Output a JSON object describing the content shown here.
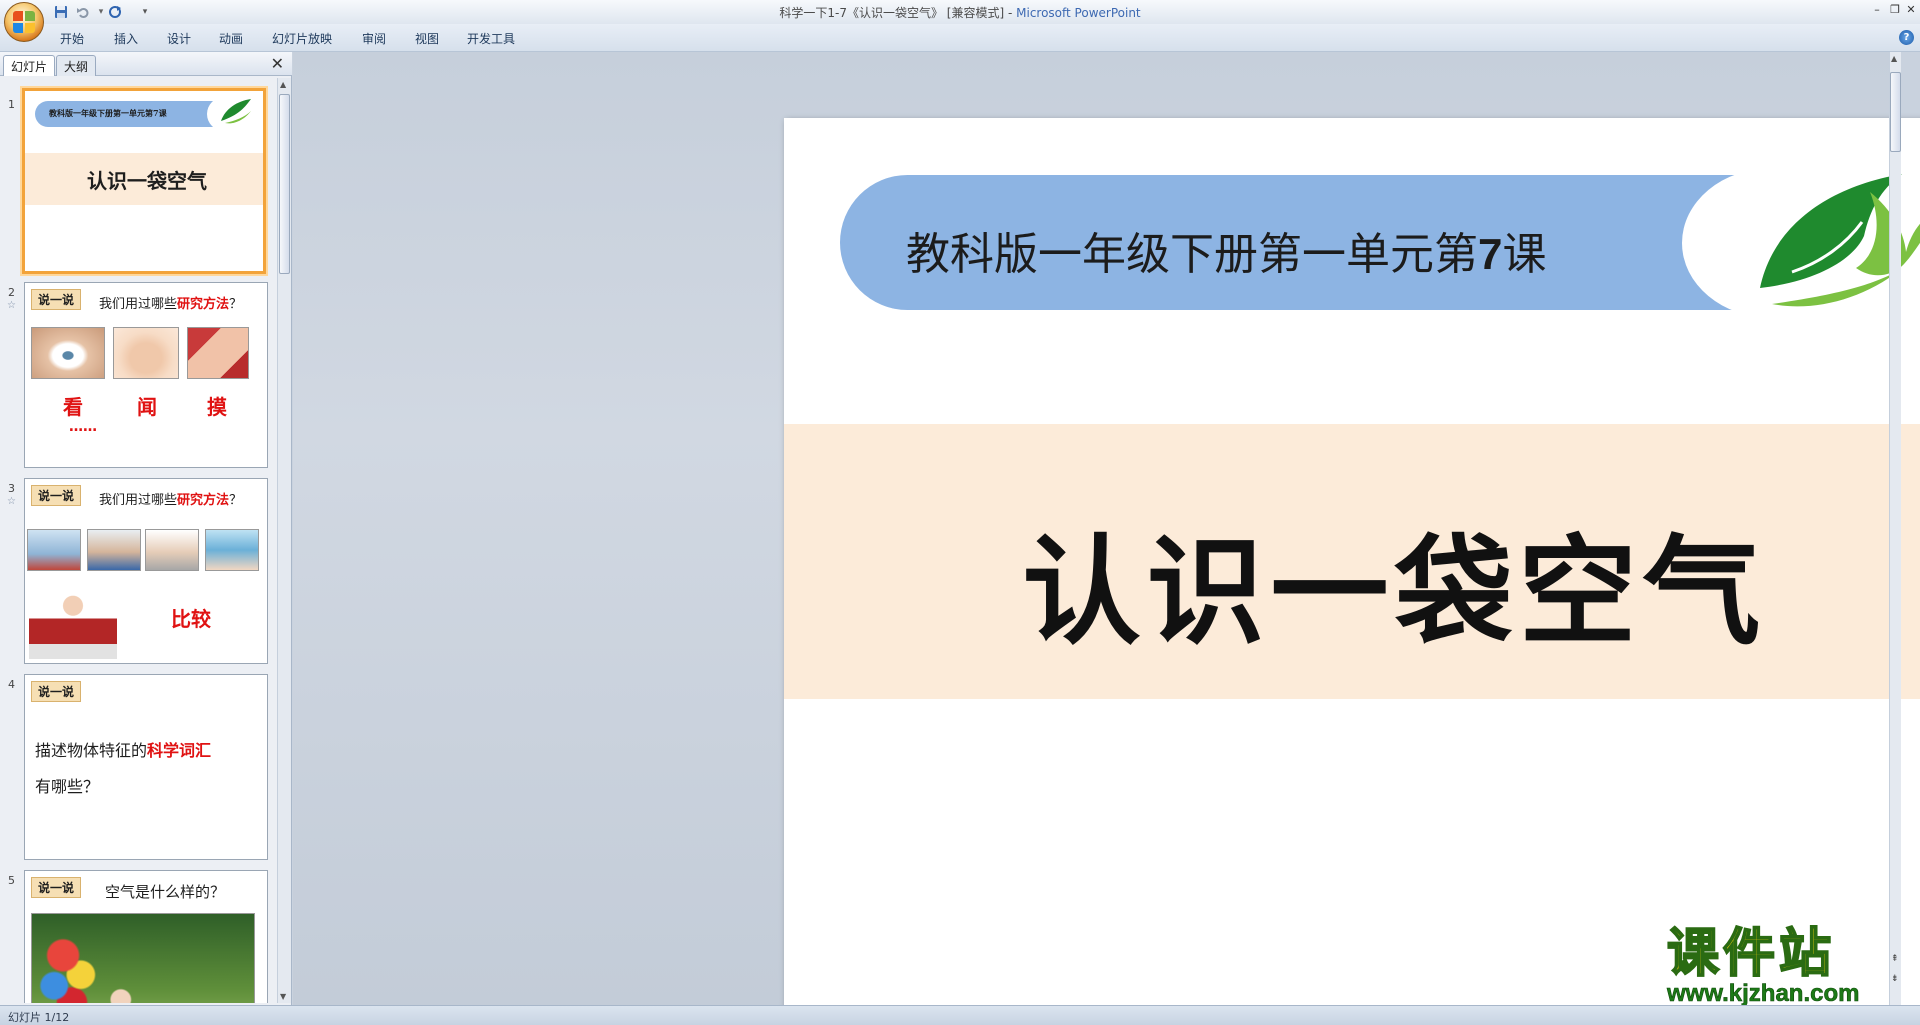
{
  "window": {
    "title_doc": "科学一下1-7《认识一袋空气》 [兼容模式] - ",
    "title_app": "Microsoft PowerPoint",
    "minimize": "–",
    "restore": "❐",
    "close": "✕"
  },
  "ribbon": {
    "tabs": [
      "开始",
      "插入",
      "设计",
      "动画",
      "幻灯片放映",
      "审阅",
      "视图",
      "开发工具"
    ],
    "help": "?"
  },
  "pane": {
    "tabs": [
      "幻灯片",
      "大纲"
    ],
    "close": "✕"
  },
  "thumbnails": [
    {
      "num": "1",
      "banner_text": "教科版一年级下册第一单元第7课",
      "title": "认识一袋空气"
    },
    {
      "num": "2",
      "tag": "说一说",
      "q_prefix": "我们用过哪些",
      "q_red": "研究方法",
      "q_suffix": "？",
      "labels": [
        "看",
        "闻",
        "摸"
      ],
      "dots": "……"
    },
    {
      "num": "3",
      "tag": "说一说",
      "q_prefix": "我们用过哪些",
      "q_red": "研究方法",
      "q_suffix": "？",
      "label": "比较"
    },
    {
      "num": "4",
      "tag": "说一说",
      "line1_prefix": "描述物体特征的",
      "line1_red": "科学词汇",
      "line2": "有哪些？"
    },
    {
      "num": "5",
      "tag": "说一说",
      "q": "空气是什么样的？"
    }
  ],
  "slide": {
    "lesson_prefix": "教科版一年级下册第一单元第",
    "lesson_number": "7",
    "lesson_suffix": "课",
    "title": "认识一袋空气"
  },
  "watermark": {
    "cn": "课件站",
    "url": "www.kjzhan.com"
  },
  "status": {
    "text": "幻灯片 1/12"
  },
  "colors": {
    "banner": "#8db4e3",
    "title_band": "#fcebd9",
    "selection": "#f2a33a",
    "accent_red": "#e01212"
  }
}
